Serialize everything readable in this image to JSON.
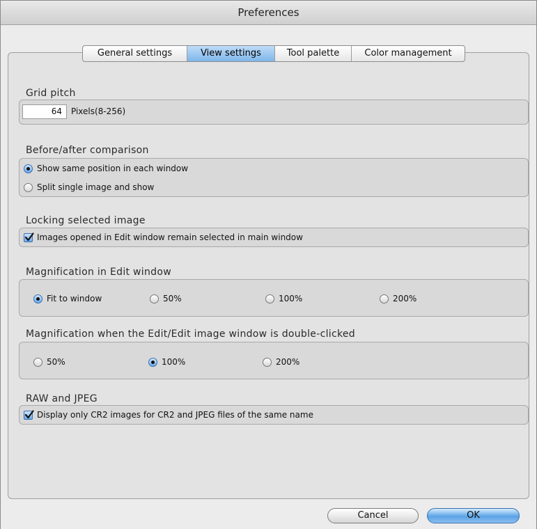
{
  "window": {
    "title": "Preferences"
  },
  "tabs": [
    {
      "label": "General settings",
      "active": false
    },
    {
      "label": "View settings",
      "active": true
    },
    {
      "label": "Tool palette",
      "active": false
    },
    {
      "label": "Color management",
      "active": false
    }
  ],
  "grid_pitch": {
    "title": "Grid pitch",
    "value": "64",
    "units": "Pixels(8-256)"
  },
  "before_after": {
    "title": "Before/after comparison",
    "options": [
      {
        "label": "Show same position in each window",
        "selected": true
      },
      {
        "label": "Split single image and show",
        "selected": false
      }
    ]
  },
  "locking": {
    "title": "Locking selected image",
    "checkbox": {
      "label": "Images opened in Edit window remain selected in main window",
      "checked": true
    }
  },
  "magnification_edit": {
    "title": "Magnification in Edit window",
    "options": [
      {
        "label": "Fit to window",
        "selected": true
      },
      {
        "label": "50%",
        "selected": false
      },
      {
        "label": "100%",
        "selected": false
      },
      {
        "label": "200%",
        "selected": false
      }
    ]
  },
  "magnification_dblclick": {
    "title": "Magnification when the Edit/Edit image window is double-clicked",
    "options": [
      {
        "label": "50%",
        "selected": false
      },
      {
        "label": "100%",
        "selected": true
      },
      {
        "label": "200%",
        "selected": false
      }
    ]
  },
  "raw_jpeg": {
    "title": "RAW and JPEG",
    "checkbox": {
      "label": "Display only CR2 images for CR2 and JPEG files of the same name",
      "checked": true
    }
  },
  "buttons": {
    "cancel": "Cancel",
    "ok": "OK"
  },
  "colors": {
    "accent": "#6aa9e8",
    "panel": "#e3e3e3"
  }
}
